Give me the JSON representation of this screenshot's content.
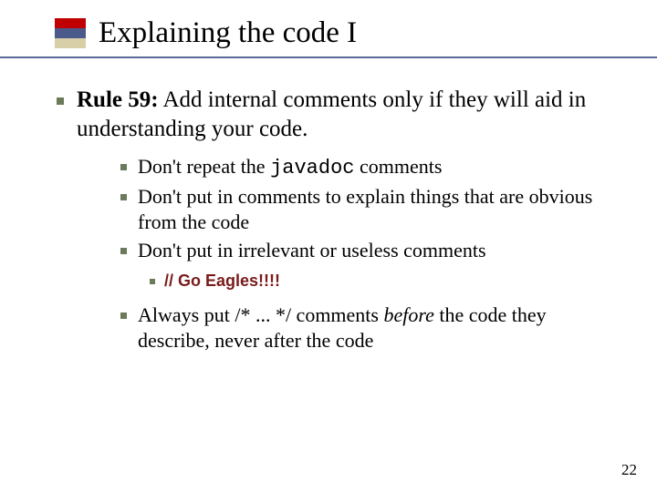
{
  "title": "Explaining the code I",
  "rule": {
    "label": "Rule 59:",
    "text": " Add internal comments only if they will aid in understanding your code."
  },
  "sub": [
    {
      "pre": "Don't repeat the ",
      "code": "javadoc",
      "post": " comments"
    },
    {
      "text": "Don't put in comments to explain things that are obvious from the code"
    },
    {
      "text": "Don't put in irrelevant or useless comments"
    }
  ],
  "subsub": "// Go Eagles!!!!",
  "sub4": {
    "pre": "Always put /* ... */ comments ",
    "em": "before",
    "post": " the code they describe, never after the code"
  },
  "pageNumber": "22"
}
